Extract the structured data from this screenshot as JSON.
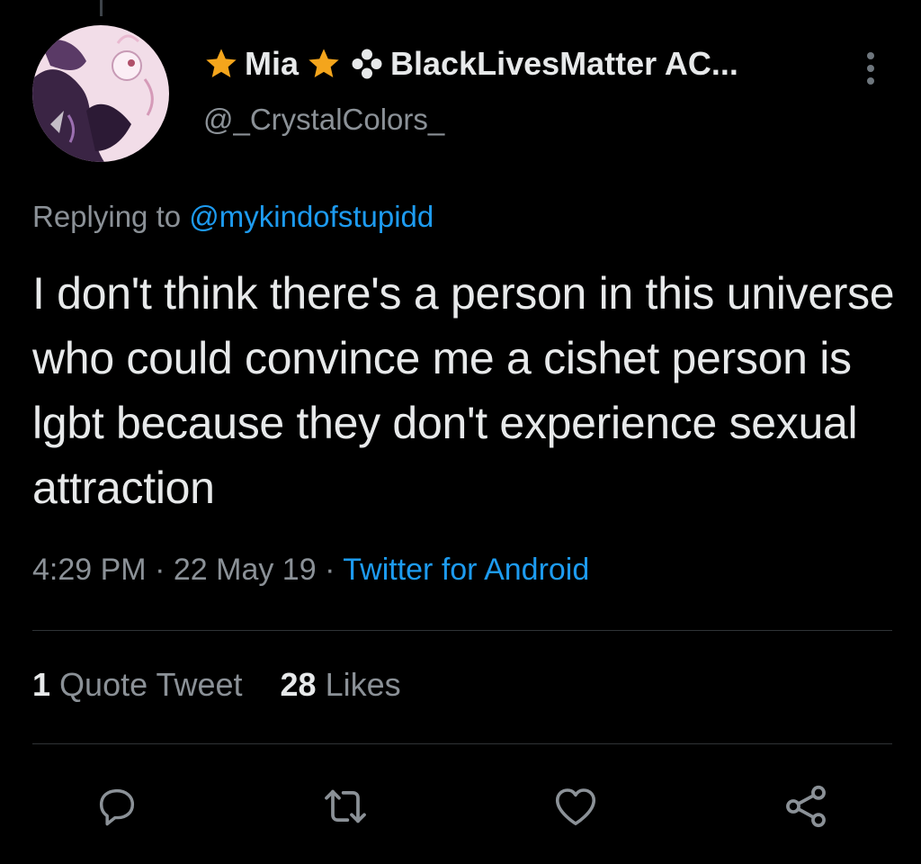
{
  "tweet": {
    "display_name": "Mia",
    "display_name_suffix": "BlackLivesMatter AC...",
    "handle": "@_CrystalColors_",
    "reply_prefix": "Replying to",
    "reply_to": "@mykindofstupidd",
    "text": "I don't think there's a person in this universe who could convince me a cishet person is lgbt because they don't experience sexual attraction",
    "time": "4:29 PM",
    "separator": "·",
    "date": "22 May 19",
    "source": "Twitter for Android"
  },
  "stats": {
    "quote_count": "1",
    "quote_label": "Quote Tweet",
    "likes_count": "28",
    "likes_label": "Likes"
  },
  "icons": {
    "name_emoji_1": "star-icon",
    "name_emoji_2": "star-icon",
    "name_emoji_3": "flower-icon",
    "more": "more-vertical-icon",
    "actions": [
      "reply-icon",
      "retweet-icon",
      "like-icon",
      "share-icon"
    ]
  },
  "colors": {
    "background": "#000000",
    "text_primary": "#e7e9ea",
    "text_secondary": "#8b9197",
    "accent": "#1d9bf0",
    "star": "#f4a51c",
    "divider": "#2f3336"
  }
}
